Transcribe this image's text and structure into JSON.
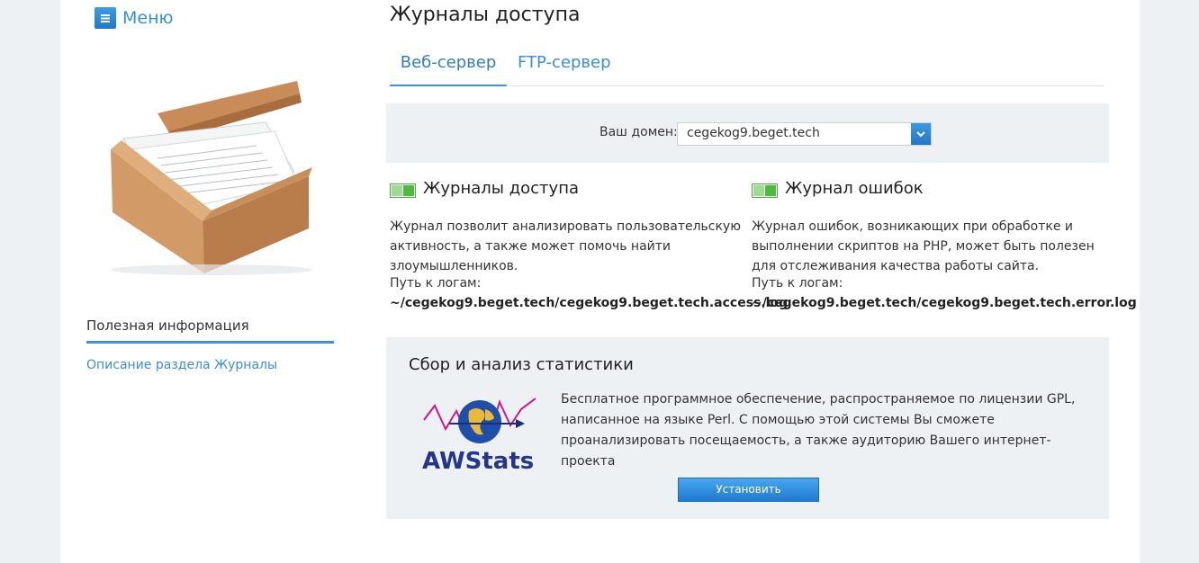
{
  "sidebar": {
    "menu_label": "Меню",
    "info_title": "Полезная информация",
    "info_link": "Описание раздела Журналы"
  },
  "main": {
    "title": "Журналы доступа",
    "tabs": [
      {
        "label": "Веб-сервер",
        "active": true
      },
      {
        "label": "FTP-сервер",
        "active": false
      }
    ],
    "domain": {
      "label": "Ваш домен:",
      "value": "cegekog9.beget.tech"
    },
    "features": [
      {
        "title": "Журналы доступа",
        "enabled": true,
        "description": "Журнал позволит анализировать пользовательскую активность, а также может помочь найти злоумышленников.",
        "path_label": "Путь к логам:",
        "path": "~/cegekog9.beget.tech/cegekog9.beget.tech.access.log"
      },
      {
        "title": "Журнал ошибок",
        "enabled": true,
        "description": "Журнал ошибок, возникающих при обработке и выполнении скриптов на PHP, может быть полезен для отслеживания качества работы сайта.",
        "path_label": "Путь к логам:",
        "path": "~/cegekog9.beget.tech/cegekog9.beget.tech.error.log"
      }
    ],
    "stats": {
      "title": "Сбор и анализ статистики",
      "logo_text": "AWStats",
      "description": "Бесплатное программное обеспечение, распространяемое по лицензии GPL, написанное на языке Perl. С помощью этой системы Вы сможете проанализировать посещаемость, а также аудиторию Вашего интернет-проекта",
      "install_label": "Установить"
    }
  },
  "colors": {
    "accent": "#3a8fd2",
    "toggle_on": "#4fb942",
    "panel_bg": "#eef1f4"
  }
}
